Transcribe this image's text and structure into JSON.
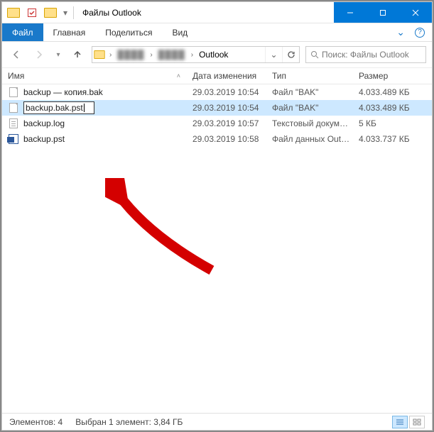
{
  "title": "Файлы Outlook",
  "ribbon": {
    "tabs": [
      "Файл",
      "Главная",
      "Поделиться",
      "Вид"
    ],
    "active_index": 0
  },
  "address": {
    "current_folder": "Outlook",
    "obscured_segment_1": "████",
    "obscured_segment_2": "████"
  },
  "search": {
    "placeholder": "Поиск: Файлы Outlook"
  },
  "columns": {
    "name": "Имя",
    "date": "Дата изменения",
    "type": "Тип",
    "size": "Размер"
  },
  "files": [
    {
      "name": "backup — копия.bak",
      "date": "29.03.2019 10:54",
      "type": "Файл \"BAK\"",
      "size": "4.033.489 КБ",
      "icon": "blank",
      "selected": false,
      "editing": false
    },
    {
      "name": "backup.bak.pst",
      "date": "29.03.2019 10:54",
      "type": "Файл \"BAK\"",
      "size": "4.033.489 КБ",
      "icon": "blank",
      "selected": true,
      "editing": true
    },
    {
      "name": "backup.log",
      "date": "29.03.2019 10:57",
      "type": "Текстовый докум…",
      "size": "5 КБ",
      "icon": "txt",
      "selected": false,
      "editing": false
    },
    {
      "name": "backup.pst",
      "date": "29.03.2019 10:58",
      "type": "Файл данных Out…",
      "size": "4.033.737 КБ",
      "icon": "pst",
      "selected": false,
      "editing": false
    }
  ],
  "status": {
    "count_label": "Элементов: 4",
    "selection_label": "Выбран 1 элемент: 3,84 ГБ"
  }
}
